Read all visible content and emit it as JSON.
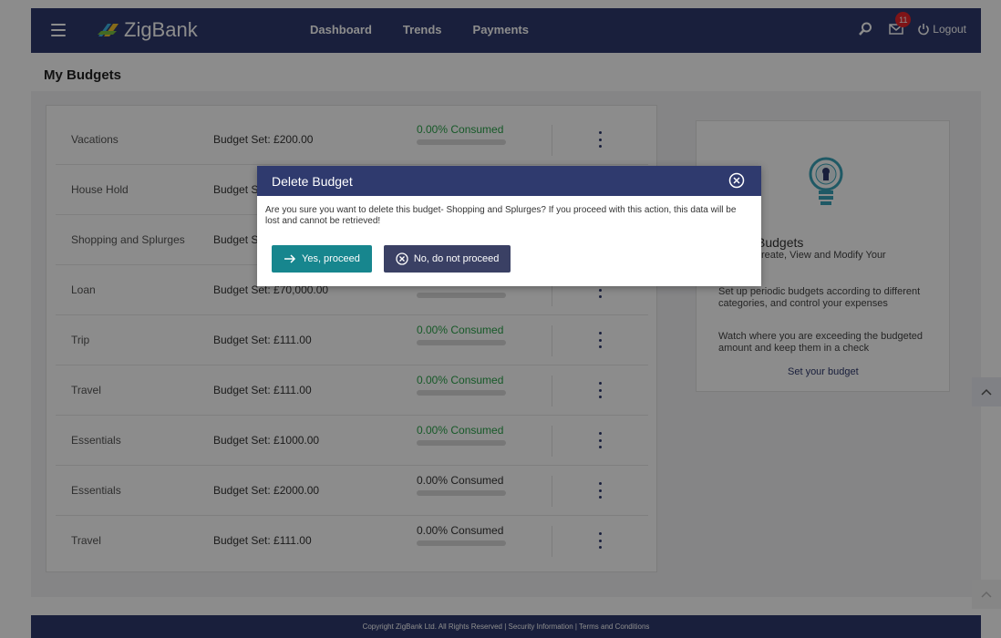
{
  "header": {
    "brand": "ZigBank",
    "nav": [
      "Dashboard",
      "Trends",
      "Payments"
    ],
    "notification_count": "11",
    "logout_label": "Logout"
  },
  "page": {
    "title": "My Budgets"
  },
  "budgets": [
    {
      "name": "Vacations",
      "budget": "Budget Set: £200.00",
      "consumed": "0.00% Consumed",
      "consumed_pct": 0
    },
    {
      "name": "House Hold",
      "budget": "Budget Set: £...",
      "consumed": "",
      "consumed_pct": 0
    },
    {
      "name": "Shopping and Splurges",
      "budget": "Budget Set: ...",
      "consumed": "",
      "consumed_pct": 0
    },
    {
      "name": "Loan",
      "budget": "Budget Set: £70,000.00",
      "consumed": "",
      "consumed_pct": 0
    },
    {
      "name": "Trip",
      "budget": "Budget Set: £111.00",
      "consumed": "0.00% Consumed",
      "consumed_pct": 0
    },
    {
      "name": "Travel",
      "budget": "Budget Set: £111.00",
      "consumed": "0.00% Consumed",
      "consumed_pct": 0
    },
    {
      "name": "Essentials",
      "budget": "Budget Set: £1000.00",
      "consumed": "0.00% Consumed",
      "consumed_pct": 0
    },
    {
      "name": "Essentials",
      "budget": "Budget Set: £2000.00",
      "consumed": "0.00% Consumed",
      "consumed_pct": 0
    },
    {
      "name": "Travel",
      "budget": "Budget Set: £111.00",
      "consumed": "0.00% Consumed",
      "consumed_pct": 0
    }
  ],
  "info": {
    "title": "Budgets",
    "subtitle": "Create, View and Modify Your",
    "p1": "Set up periodic budgets according to different categories, and control your expenses",
    "p2": "Watch where you are exceeding the budgeted amount and keep them in a check",
    "link": "Set your budget"
  },
  "footer": {
    "text": "Copyright ZigBank Ltd. All Rights Reserved | Security Information | Terms and Conditions"
  },
  "modal": {
    "title": "Delete Budget",
    "message": "Are you sure you want to delete this budget- Shopping and Splurges? If you proceed with this action, this data will be lost and cannot be retrieved!",
    "yes_label": "Yes, proceed",
    "no_label": "No, do not proceed"
  },
  "colors": {
    "brand_navy": "#2f3a6e",
    "teal": "#17868e",
    "consumed_green": "#2aa34a",
    "badge_red": "#e8262b"
  }
}
